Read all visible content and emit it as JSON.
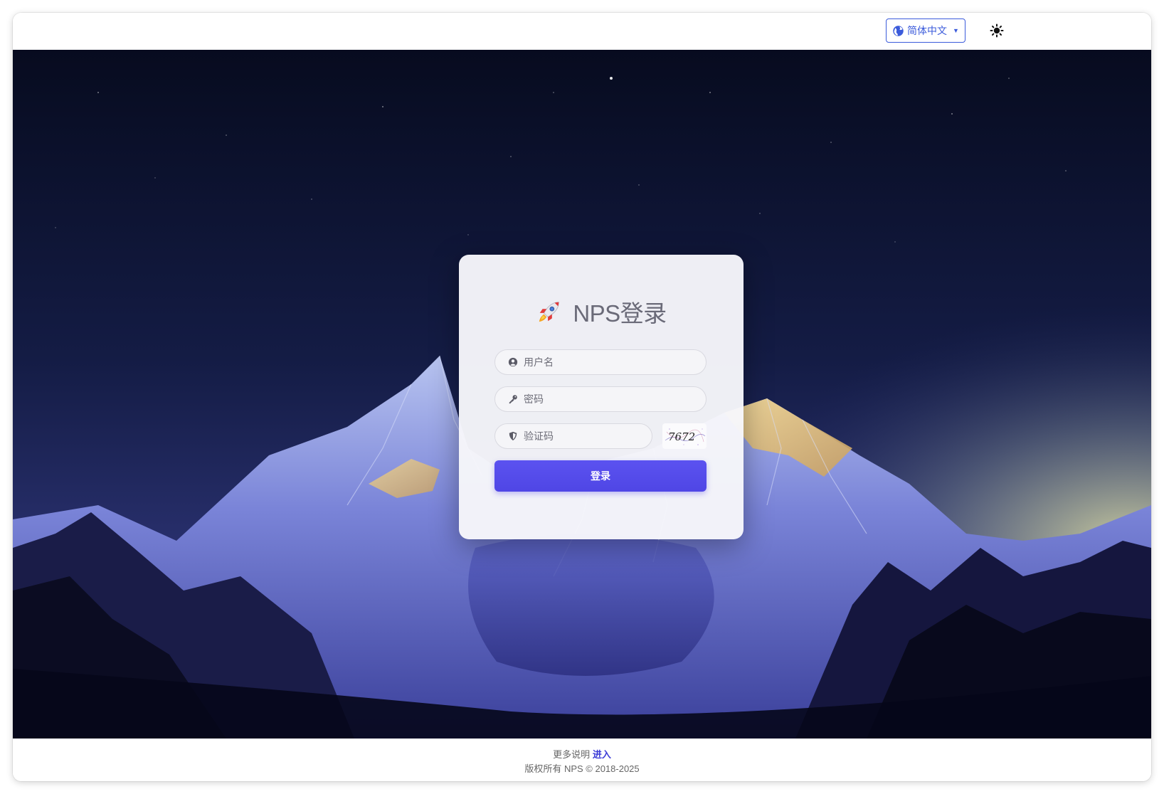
{
  "navbar": {
    "language_label": "简体中文"
  },
  "login": {
    "title": "NPS登录",
    "username_placeholder": "用户名",
    "password_placeholder": "密码",
    "captcha_placeholder": "验证码",
    "captcha_text": "7672",
    "submit_label": "登录"
  },
  "footer": {
    "more_info_label": "更多说明",
    "enter_link": "进入",
    "copyright": "版权所有 NPS © 2018-2025"
  },
  "colors": {
    "accent": "#4f46e5",
    "link": "#3b5bdb"
  },
  "icons": {
    "language": "globe-icon",
    "theme": "sun-icon",
    "logo": "rocket-icon",
    "username": "user-circle-icon",
    "password": "key-icon",
    "captcha": "shield-icon"
  }
}
